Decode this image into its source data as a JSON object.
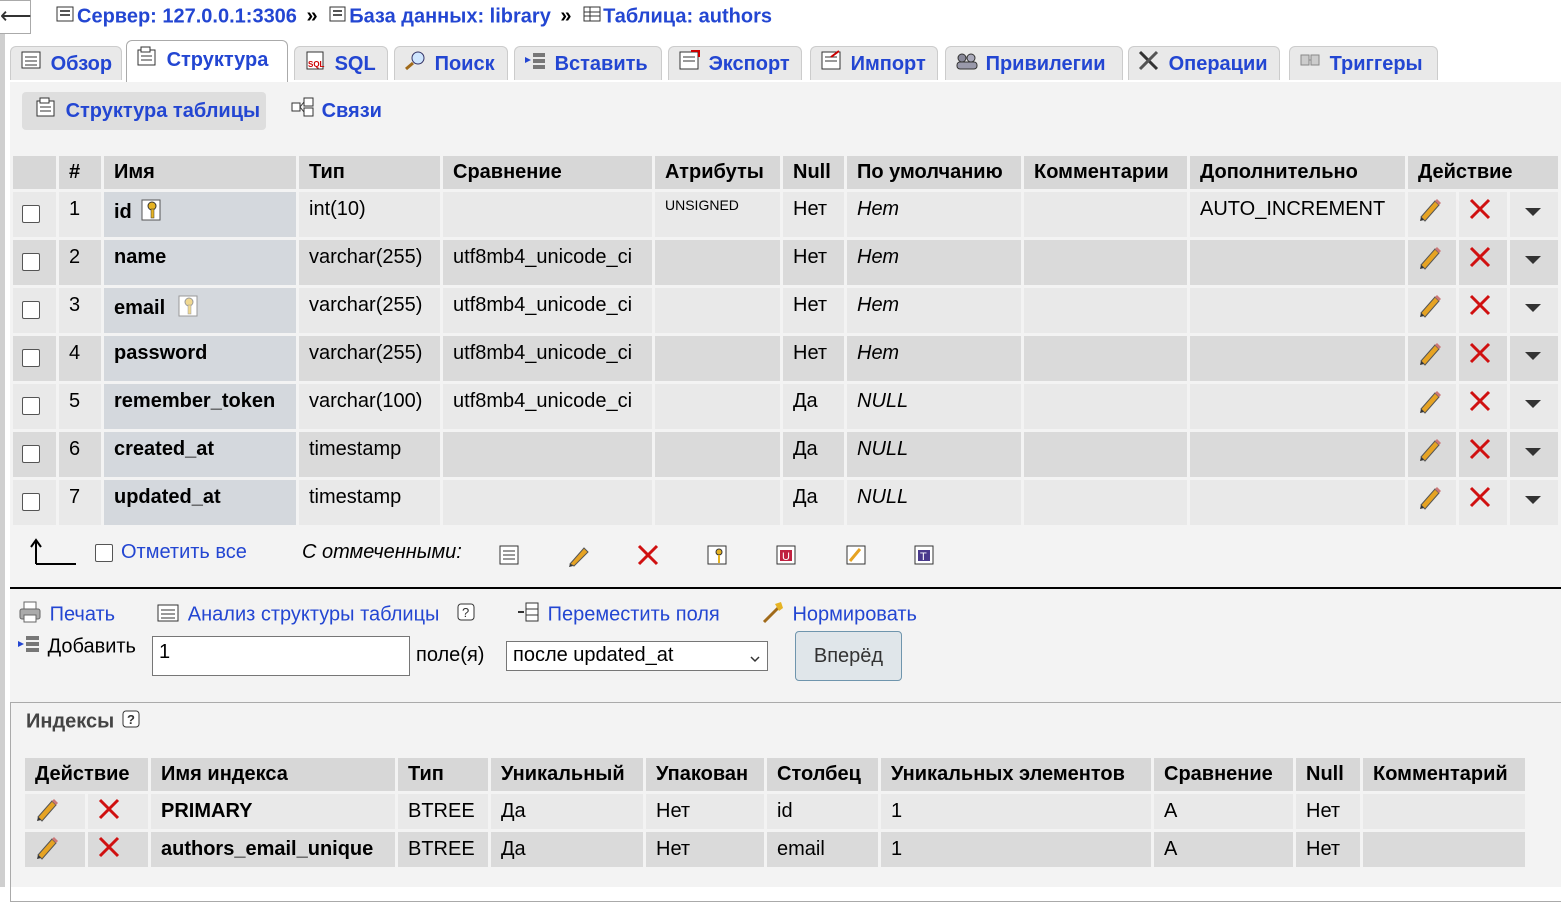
{
  "breadcrumb": {
    "server": "Сервер: 127.0.0.1:3306",
    "sep": "»",
    "database": "База данных: library",
    "table": "Таблица: authors"
  },
  "tabs": [
    {
      "label": "Обзор",
      "icon": "browse-icon"
    },
    {
      "label": "Структура",
      "icon": "structure-icon"
    },
    {
      "label": "SQL",
      "icon": "sql-icon"
    },
    {
      "label": "Поиск",
      "icon": "search-icon"
    },
    {
      "label": "Вставить",
      "icon": "insert-icon"
    },
    {
      "label": "Экспорт",
      "icon": "export-icon"
    },
    {
      "label": "Импорт",
      "icon": "import-icon"
    },
    {
      "label": "Привилегии",
      "icon": "privileges-icon"
    },
    {
      "label": "Операции",
      "icon": "operations-icon"
    },
    {
      "label": "Триггеры",
      "icon": "triggers-icon"
    }
  ],
  "subtabs": {
    "structure": "Структура таблицы",
    "relations": "Связи"
  },
  "columns_table": {
    "headers": [
      "#",
      "Имя",
      "Тип",
      "Сравнение",
      "Атрибуты",
      "Null",
      "По умолчанию",
      "Комментарии",
      "Дополнительно",
      "Действие"
    ],
    "rows": [
      {
        "num": "1",
        "name": "id",
        "type": "int(10)",
        "collation": "",
        "attributes": "UNSIGNED",
        "null": "Нет",
        "default": "Нет",
        "comments": "",
        "extra": "AUTO_INCREMENT",
        "key": "primary"
      },
      {
        "num": "2",
        "name": "name",
        "type": "varchar(255)",
        "collation": "utf8mb4_unicode_ci",
        "attributes": "",
        "null": "Нет",
        "default": "Нет",
        "comments": "",
        "extra": "",
        "key": ""
      },
      {
        "num": "3",
        "name": "email",
        "type": "varchar(255)",
        "collation": "utf8mb4_unicode_ci",
        "attributes": "",
        "null": "Нет",
        "default": "Нет",
        "comments": "",
        "extra": "",
        "key": "unique"
      },
      {
        "num": "4",
        "name": "password",
        "type": "varchar(255)",
        "collation": "utf8mb4_unicode_ci",
        "attributes": "",
        "null": "Нет",
        "default": "Нет",
        "comments": "",
        "extra": "",
        "key": ""
      },
      {
        "num": "5",
        "name": "remember_token",
        "type": "varchar(100)",
        "collation": "utf8mb4_unicode_ci",
        "attributes": "",
        "null": "Да",
        "default": "NULL",
        "comments": "",
        "extra": "",
        "key": ""
      },
      {
        "num": "6",
        "name": "created_at",
        "type": "timestamp",
        "collation": "",
        "attributes": "",
        "null": "Да",
        "default": "NULL",
        "comments": "",
        "extra": "",
        "key": ""
      },
      {
        "num": "7",
        "name": "updated_at",
        "type": "timestamp",
        "collation": "",
        "attributes": "",
        "null": "Да",
        "default": "NULL",
        "comments": "",
        "extra": "",
        "key": ""
      }
    ]
  },
  "bulk": {
    "check_all": "Отметить все",
    "with_selected": "С отмеченными:"
  },
  "actions": {
    "print": "Печать",
    "analyze": "Анализ структуры таблицы",
    "move_columns": "Переместить поля",
    "normalize": "Нормировать",
    "add_label": "Добавить",
    "add_count": "1",
    "fields_label": "поле(я)",
    "position_selected": "после updated_at",
    "go": "Вперёд"
  },
  "indexes": {
    "legend": "Индексы",
    "headers": [
      "Действие",
      "Имя индекса",
      "Тип",
      "Уникальный",
      "Упакован",
      "Столбец",
      "Уникальных элементов",
      "Сравнение",
      "Null",
      "Комментарий"
    ],
    "rows": [
      {
        "name": "PRIMARY",
        "type": "BTREE",
        "unique": "Да",
        "packed": "Нет",
        "column": "id",
        "cardinality": "1",
        "collation": "A",
        "null": "Нет",
        "comment": ""
      },
      {
        "name": "authors_email_unique",
        "type": "BTREE",
        "unique": "Да",
        "packed": "Нет",
        "column": "email",
        "cardinality": "1",
        "collation": "A",
        "null": "Нет",
        "comment": ""
      }
    ]
  },
  "colors": {
    "link": "#2346d2",
    "header_bg": "#d7d7d7",
    "row_odd": "#e9e9e9",
    "row_even": "#dadada",
    "delete_red": "#d01010"
  }
}
